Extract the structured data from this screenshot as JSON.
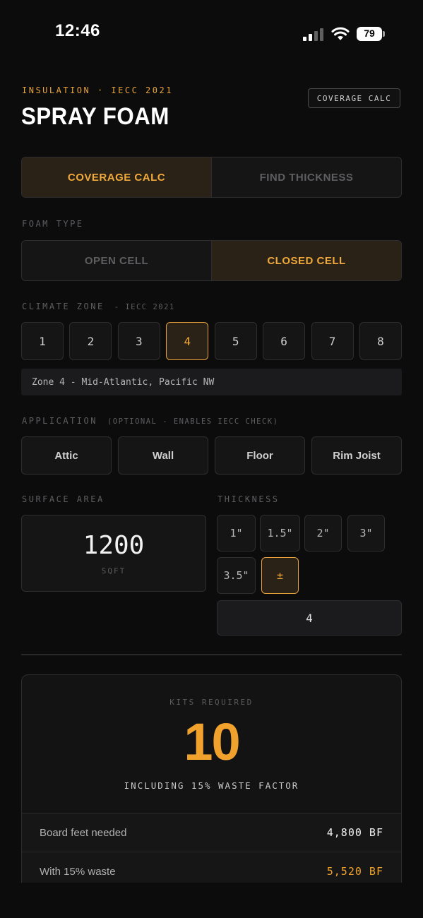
{
  "status": {
    "time": "12:46",
    "battery": "79"
  },
  "header": {
    "eyebrow": "INSULATION · IECC 2021",
    "title": "SPRAY FOAM",
    "mode_badge": "COVERAGE CALC"
  },
  "mode_tabs": [
    {
      "label": "COVERAGE CALC",
      "active": true
    },
    {
      "label": "FIND THICKNESS",
      "active": false
    }
  ],
  "foam_type": {
    "label": "FOAM TYPE",
    "options": [
      {
        "label": "OPEN CELL",
        "active": false
      },
      {
        "label": "CLOSED CELL",
        "active": true
      }
    ]
  },
  "climate_zone": {
    "label": "CLIMATE ZONE",
    "sublabel": "- IECC 2021",
    "zones": [
      "1",
      "2",
      "3",
      "4",
      "5",
      "6",
      "7",
      "8"
    ],
    "selected": "4",
    "description": "Zone 4 - Mid-Atlantic, Pacific NW"
  },
  "application": {
    "label": "APPLICATION",
    "sublabel": "(OPTIONAL - ENABLES IECC CHECK)",
    "options": [
      "Attic",
      "Wall",
      "Floor",
      "Rim Joist"
    ]
  },
  "surface_area": {
    "label": "SURFACE AREA",
    "value": "1200",
    "unit": "SQFT"
  },
  "thickness": {
    "label": "THICKNESS",
    "options": [
      "1\"",
      "1.5\"",
      "2\"",
      "3\"",
      "3.5\"",
      "±"
    ],
    "selected": "±",
    "custom_value": "4"
  },
  "result": {
    "label": "KITS REQUIRED",
    "value": "10",
    "sub": "INCLUDING 15% WASTE FACTOR",
    "rows": [
      {
        "label": "Board feet needed",
        "value": "4,800 BF"
      },
      {
        "label": "With 15% waste",
        "value": "5,520 BF"
      }
    ]
  },
  "colors": {
    "accent": "#f0a22c",
    "background": "#0c0c0d",
    "panel": "#151516",
    "border": "#2e2e30"
  },
  "icons": [
    "signal-icon",
    "wifi-icon",
    "battery-icon"
  ]
}
